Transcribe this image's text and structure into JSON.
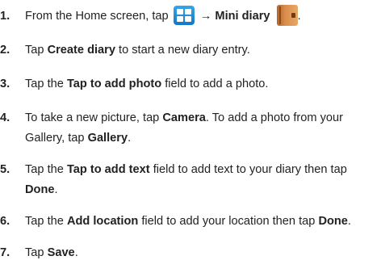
{
  "steps": [
    {
      "number": "1.",
      "before": "From the Home screen, tap ",
      "arrow": "→",
      "bold1": "Mini diary",
      "after": "."
    },
    {
      "number": "2.",
      "before": "Tap ",
      "bold1": "Create diary",
      "after": " to start a new diary entry."
    },
    {
      "number": "3.",
      "before": "Tap the ",
      "bold1": "Tap to add photo",
      "after": " field to add a photo."
    },
    {
      "number": "4.",
      "before": "To take a new picture, tap ",
      "bold1": "Camera",
      "middle": ". To add a photo from your Gallery, tap ",
      "bold2": "Gallery",
      "after": "."
    },
    {
      "number": "5.",
      "before": "Tap the ",
      "bold1": "Tap to add text",
      "middle": " field to add text to your diary then tap ",
      "bold2": "Done",
      "after": "."
    },
    {
      "number": "6.",
      "before": "Tap the ",
      "bold1": "Add location",
      "middle": " field to add your location then tap ",
      "bold2": "Done",
      "after": "."
    },
    {
      "number": "7.",
      "before": "Tap ",
      "bold1": "Save",
      "after": "."
    }
  ],
  "icons": {
    "apps": "apps-grid-icon",
    "diary": "mini-diary-icon",
    "apps_color": "#1f8fd8",
    "diary_color": "#c97a3a"
  }
}
